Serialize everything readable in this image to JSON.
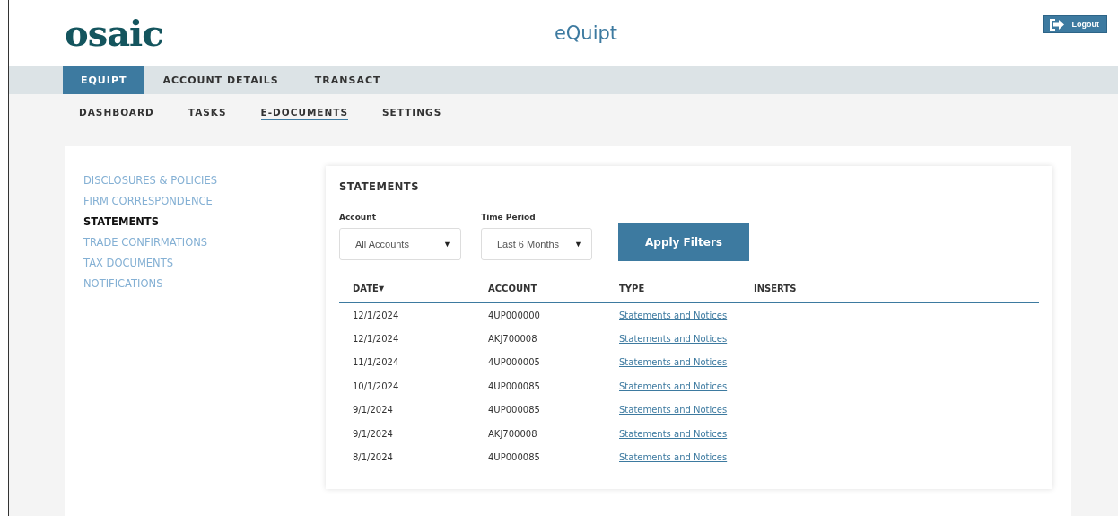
{
  "header": {
    "logo": "osaic",
    "app_title": "eQuipt",
    "logout": "Logout"
  },
  "main_tabs": [
    {
      "label": "EQUIPT",
      "selected": true
    },
    {
      "label": "ACCOUNT DETAILS",
      "selected": false
    },
    {
      "label": "TRANSACT",
      "selected": false
    }
  ],
  "sub_tabs": [
    {
      "label": "DASHBOARD",
      "selected": false
    },
    {
      "label": "TASKS",
      "selected": false
    },
    {
      "label": "E-DOCUMENTS",
      "selected": true
    },
    {
      "label": "SETTINGS",
      "selected": false
    }
  ],
  "sidebar": {
    "items": [
      {
        "label": "DISCLOSURES & POLICIES",
        "selected": false
      },
      {
        "label": "FIRM CORRESPONDENCE",
        "selected": false
      },
      {
        "label": "STATEMENTS",
        "selected": true
      },
      {
        "label": "TRADE CONFIRMATIONS",
        "selected": false
      },
      {
        "label": "TAX DOCUMENTS",
        "selected": false
      },
      {
        "label": "NOTIFICATIONS",
        "selected": false
      }
    ]
  },
  "statements": {
    "title": "STATEMENTS",
    "filters": [
      {
        "label": "Account",
        "value": "All Accounts",
        "caret": "▼"
      },
      {
        "label": "Time Period",
        "value": "Last 6 Months",
        "caret": "▼"
      }
    ],
    "apply_button": "Apply Filters",
    "table": {
      "columns": [
        {
          "label": "DATE",
          "sort": "▼"
        },
        {
          "label": "ACCOUNT"
        },
        {
          "label": "TYPE"
        },
        {
          "label": "INSERTS"
        }
      ],
      "rows": [
        {
          "date": "12/1/2024",
          "account": "4UP000000",
          "type": "Statements and Notices"
        },
        {
          "date": "12/1/2024",
          "account": "AKJ700008",
          "type": "Statements and Notices"
        },
        {
          "date": "11/1/2024",
          "account": "4UP000005",
          "type": "Statements and Notices"
        },
        {
          "date": "10/1/2024",
          "account": "4UP000085",
          "type": "Statements and Notices"
        },
        {
          "date": "9/1/2024",
          "account": "4UP000085",
          "type": "Statements and Notices"
        },
        {
          "date": "9/1/2024",
          "account": "AKJ700008",
          "type": "Statements and Notices"
        },
        {
          "date": "8/1/2024",
          "account": "4UP000085",
          "type": "Statements and Notices"
        }
      ]
    }
  }
}
